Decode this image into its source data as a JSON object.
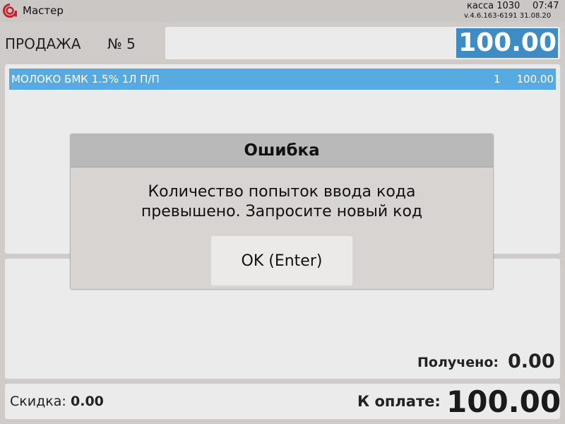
{
  "app": {
    "title": "Мастер",
    "kassa": "касса 1030",
    "time": "07:47",
    "version": "v.4.6.163-6191  31.08.20",
    "logo_icon": "brand-logo-icon",
    "brand_color": "#c8202c"
  },
  "sale": {
    "label": "ПРОДАЖА",
    "number": "№ 5",
    "total": "100.00",
    "accent_color": "#3d8dc4"
  },
  "items": [
    {
      "name": "МОЛОКО БМК 1.5% 1Л П/П",
      "qty": "1",
      "sum": "100.00"
    }
  ],
  "payment": {
    "received_label": "Получено:",
    "received_value": "0.00",
    "discount_label": "Скидка:",
    "discount_value": "0.00",
    "topay_label": "К оплате:",
    "topay_value": "100.00"
  },
  "dialog": {
    "title": "Ошибка",
    "message_line1": "Количество попыток ввода кода",
    "message_line2": "превышено. Запросите новый код",
    "ok_label": "OK (Enter)"
  }
}
